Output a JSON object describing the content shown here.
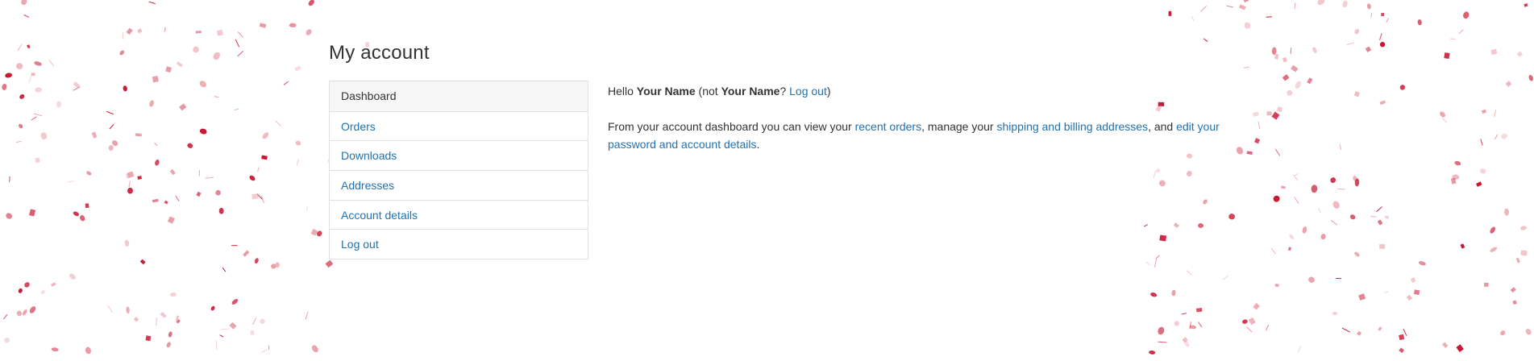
{
  "page": {
    "title": "My account"
  },
  "nav": {
    "items": [
      {
        "label": "Dashboard",
        "active": true
      },
      {
        "label": "Orders",
        "active": false
      },
      {
        "label": "Downloads",
        "active": false
      },
      {
        "label": "Addresses",
        "active": false
      },
      {
        "label": "Account details",
        "active": false
      },
      {
        "label": "Log out",
        "active": false
      }
    ]
  },
  "greeting": {
    "hello": "Hello ",
    "name": "Your Name",
    "not_open": " (not ",
    "name_again": "Your Name",
    "question": "? ",
    "logout_link": "Log out",
    "close": ")"
  },
  "intro": {
    "text1": "From your account dashboard you can view your ",
    "link_orders": "recent orders",
    "text2": ", manage your ",
    "link_addresses": "shipping and billing addresses",
    "text3": ", and ",
    "link_account": "edit your password and account details",
    "text4": "."
  },
  "colors": {
    "link": "#2271b1",
    "confetti_dark": "#c8102e",
    "confetti_light": "#e89aa3"
  }
}
